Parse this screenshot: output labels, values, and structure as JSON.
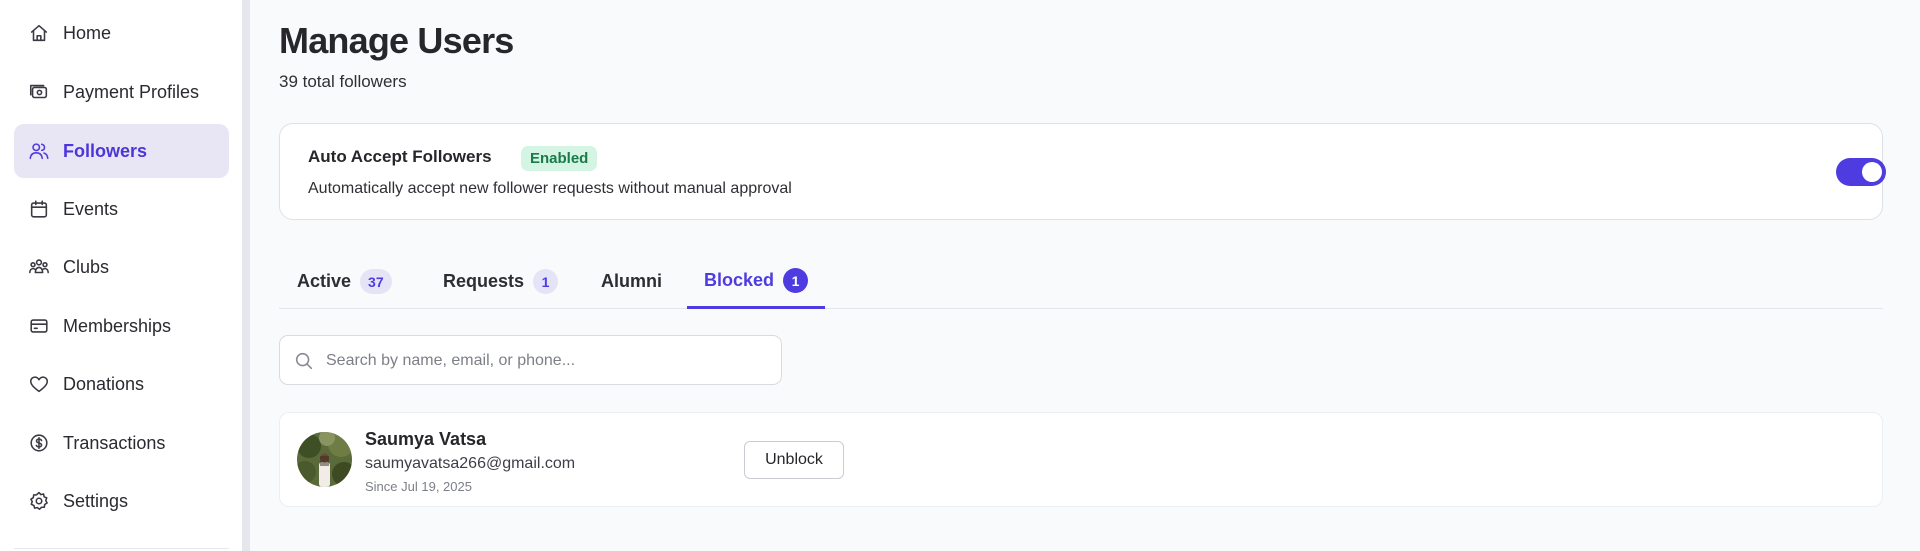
{
  "sidebar": {
    "items": [
      {
        "label": "Home",
        "icon": "home-icon"
      },
      {
        "label": "Payment Profiles",
        "icon": "wallet-icon"
      },
      {
        "label": "Followers",
        "icon": "users-icon",
        "active": true
      },
      {
        "label": "Events",
        "icon": "calendar-icon"
      },
      {
        "label": "Clubs",
        "icon": "group-icon"
      },
      {
        "label": "Memberships",
        "icon": "card-icon"
      },
      {
        "label": "Donations",
        "icon": "heart-icon"
      },
      {
        "label": "Transactions",
        "icon": "dollar-circle-icon"
      },
      {
        "label": "Settings",
        "icon": "gear-icon"
      }
    ]
  },
  "header": {
    "title": "Manage Users",
    "subtitle": "39 total followers"
  },
  "auto_accept": {
    "title": "Auto Accept Followers",
    "badge": "Enabled",
    "description": "Automatically accept new follower requests without manual approval",
    "toggle_on": true
  },
  "tabs": [
    {
      "label": "Active",
      "count": "37"
    },
    {
      "label": "Requests",
      "count": "1"
    },
    {
      "label": "Alumni",
      "count": ""
    },
    {
      "label": "Blocked",
      "count": "1",
      "active": true
    }
  ],
  "search": {
    "placeholder": "Search by name, email, or phone...",
    "value": ""
  },
  "users": [
    {
      "name": "Saumya Vatsa",
      "email": "saumyavatsa266@gmail.com",
      "since": "Since Jul 19, 2025",
      "action": "Unblock"
    }
  ],
  "colors": {
    "accent": "#4f3ce0",
    "active_nav_bg": "#e8e6f5",
    "badge_bg": "#d4f5e4",
    "badge_text": "#1a7a4a"
  }
}
